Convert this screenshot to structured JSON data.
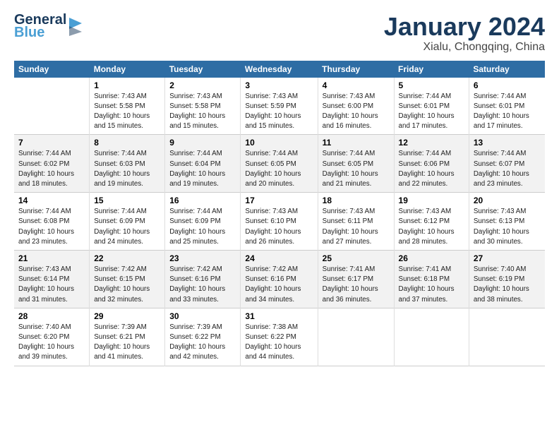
{
  "header": {
    "logo_line1": "General",
    "logo_line2": "Blue",
    "month": "January 2024",
    "location": "Xialu, Chongqing, China"
  },
  "weekdays": [
    "Sunday",
    "Monday",
    "Tuesday",
    "Wednesday",
    "Thursday",
    "Friday",
    "Saturday"
  ],
  "weeks": [
    [
      {
        "day": "",
        "info": ""
      },
      {
        "day": "1",
        "info": "Sunrise: 7:43 AM\nSunset: 5:58 PM\nDaylight: 10 hours\nand 15 minutes."
      },
      {
        "day": "2",
        "info": "Sunrise: 7:43 AM\nSunset: 5:58 PM\nDaylight: 10 hours\nand 15 minutes."
      },
      {
        "day": "3",
        "info": "Sunrise: 7:43 AM\nSunset: 5:59 PM\nDaylight: 10 hours\nand 15 minutes."
      },
      {
        "day": "4",
        "info": "Sunrise: 7:43 AM\nSunset: 6:00 PM\nDaylight: 10 hours\nand 16 minutes."
      },
      {
        "day": "5",
        "info": "Sunrise: 7:44 AM\nSunset: 6:01 PM\nDaylight: 10 hours\nand 17 minutes."
      },
      {
        "day": "6",
        "info": "Sunrise: 7:44 AM\nSunset: 6:01 PM\nDaylight: 10 hours\nand 17 minutes."
      }
    ],
    [
      {
        "day": "7",
        "info": "Sunrise: 7:44 AM\nSunset: 6:02 PM\nDaylight: 10 hours\nand 18 minutes."
      },
      {
        "day": "8",
        "info": "Sunrise: 7:44 AM\nSunset: 6:03 PM\nDaylight: 10 hours\nand 19 minutes."
      },
      {
        "day": "9",
        "info": "Sunrise: 7:44 AM\nSunset: 6:04 PM\nDaylight: 10 hours\nand 19 minutes."
      },
      {
        "day": "10",
        "info": "Sunrise: 7:44 AM\nSunset: 6:05 PM\nDaylight: 10 hours\nand 20 minutes."
      },
      {
        "day": "11",
        "info": "Sunrise: 7:44 AM\nSunset: 6:05 PM\nDaylight: 10 hours\nand 21 minutes."
      },
      {
        "day": "12",
        "info": "Sunrise: 7:44 AM\nSunset: 6:06 PM\nDaylight: 10 hours\nand 22 minutes."
      },
      {
        "day": "13",
        "info": "Sunrise: 7:44 AM\nSunset: 6:07 PM\nDaylight: 10 hours\nand 23 minutes."
      }
    ],
    [
      {
        "day": "14",
        "info": "Sunrise: 7:44 AM\nSunset: 6:08 PM\nDaylight: 10 hours\nand 23 minutes."
      },
      {
        "day": "15",
        "info": "Sunrise: 7:44 AM\nSunset: 6:09 PM\nDaylight: 10 hours\nand 24 minutes."
      },
      {
        "day": "16",
        "info": "Sunrise: 7:44 AM\nSunset: 6:09 PM\nDaylight: 10 hours\nand 25 minutes."
      },
      {
        "day": "17",
        "info": "Sunrise: 7:43 AM\nSunset: 6:10 PM\nDaylight: 10 hours\nand 26 minutes."
      },
      {
        "day": "18",
        "info": "Sunrise: 7:43 AM\nSunset: 6:11 PM\nDaylight: 10 hours\nand 27 minutes."
      },
      {
        "day": "19",
        "info": "Sunrise: 7:43 AM\nSunset: 6:12 PM\nDaylight: 10 hours\nand 28 minutes."
      },
      {
        "day": "20",
        "info": "Sunrise: 7:43 AM\nSunset: 6:13 PM\nDaylight: 10 hours\nand 30 minutes."
      }
    ],
    [
      {
        "day": "21",
        "info": "Sunrise: 7:43 AM\nSunset: 6:14 PM\nDaylight: 10 hours\nand 31 minutes."
      },
      {
        "day": "22",
        "info": "Sunrise: 7:42 AM\nSunset: 6:15 PM\nDaylight: 10 hours\nand 32 minutes."
      },
      {
        "day": "23",
        "info": "Sunrise: 7:42 AM\nSunset: 6:16 PM\nDaylight: 10 hours\nand 33 minutes."
      },
      {
        "day": "24",
        "info": "Sunrise: 7:42 AM\nSunset: 6:16 PM\nDaylight: 10 hours\nand 34 minutes."
      },
      {
        "day": "25",
        "info": "Sunrise: 7:41 AM\nSunset: 6:17 PM\nDaylight: 10 hours\nand 36 minutes."
      },
      {
        "day": "26",
        "info": "Sunrise: 7:41 AM\nSunset: 6:18 PM\nDaylight: 10 hours\nand 37 minutes."
      },
      {
        "day": "27",
        "info": "Sunrise: 7:40 AM\nSunset: 6:19 PM\nDaylight: 10 hours\nand 38 minutes."
      }
    ],
    [
      {
        "day": "28",
        "info": "Sunrise: 7:40 AM\nSunset: 6:20 PM\nDaylight: 10 hours\nand 39 minutes."
      },
      {
        "day": "29",
        "info": "Sunrise: 7:39 AM\nSunset: 6:21 PM\nDaylight: 10 hours\nand 41 minutes."
      },
      {
        "day": "30",
        "info": "Sunrise: 7:39 AM\nSunset: 6:22 PM\nDaylight: 10 hours\nand 42 minutes."
      },
      {
        "day": "31",
        "info": "Sunrise: 7:38 AM\nSunset: 6:22 PM\nDaylight: 10 hours\nand 44 minutes."
      },
      {
        "day": "",
        "info": ""
      },
      {
        "day": "",
        "info": ""
      },
      {
        "day": "",
        "info": ""
      }
    ]
  ]
}
